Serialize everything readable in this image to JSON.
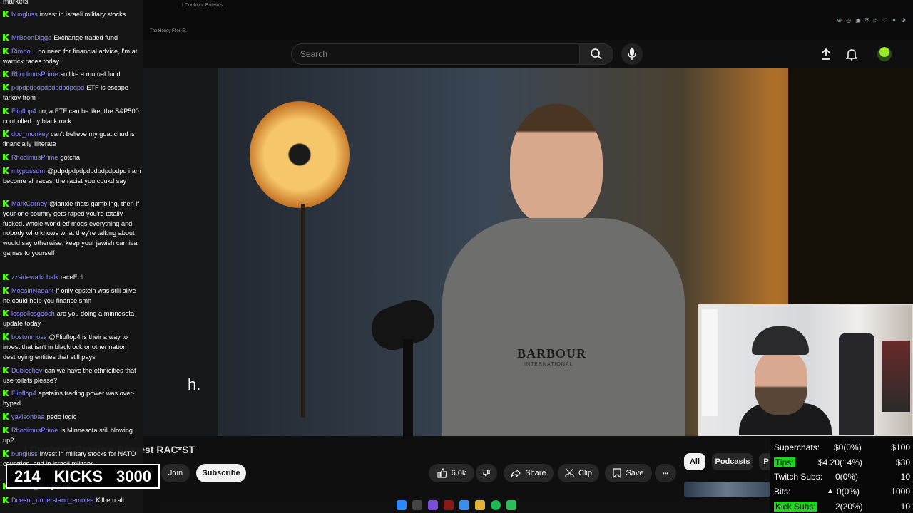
{
  "browser": {
    "tab_title": "I Confront Britain's ...",
    "bookmark_title": "The Honey Files E..."
  },
  "youtube_header": {
    "search_placeholder": "Search"
  },
  "video": {
    "caption_text": "h.",
    "sweatshirt_brand": "BARBOUR",
    "sweatshirt_sub": "INTERNATIONAL"
  },
  "below_video": {
    "title": "I Confront Britain's Biggest RAC*ST",
    "join_label": "Join",
    "subscribe_label": "Subscribe",
    "like_count": "6.6k",
    "share_label": "Share",
    "clip_label": "Clip",
    "save_label": "Save",
    "more_label": "•••"
  },
  "chips": {
    "all": "All",
    "podcasts": "Podcasts",
    "more": "P"
  },
  "chat": {
    "top_fragment": "markets",
    "messages": [
      {
        "user": "bungluss",
        "text": "invest in israeli military stocks"
      },
      {
        "user": "MrBoonDigga",
        "text": "Exchange traded fund"
      },
      {
        "user": "Rimbo...",
        "text": "no need for financial advice, I'm at warrick races today"
      },
      {
        "user": "RhodimusPrime",
        "text": "so like a mutual fund"
      },
      {
        "user": "pdpdpdpdpdpdpdpdpdpd",
        "text": "ETF is escape tarkov from"
      },
      {
        "user": "Flipflop4",
        "text": "no, a ETF can be like, the S&P500 controlled by black rock"
      },
      {
        "user": "doc_monkey",
        "text": "can't believe my goat chud is financially illiterate"
      },
      {
        "user": "RhodimusPrime",
        "text": "gotcha"
      },
      {
        "user": "mtypossum",
        "text": "@pdpdpdpdpdpdpdpdpdpd i am become all races. the racist you coukd say"
      },
      {
        "user": "MarkCarney",
        "text": "@lanxie thats gambling, then if your one country gets raped you're totally fucked. whole world etf mogs everything and nobody who knows what they're talking about would say otherwise, keep your jewish carnival games to yourself"
      },
      {
        "user": "zzsidewalkchalk",
        "text": "raceFUL"
      },
      {
        "user": "MoesinNagant",
        "text": "if only epstein was still alive he could help you finance smh"
      },
      {
        "user": "lospollosgooch",
        "text": "are you doing a minnesota update today"
      },
      {
        "user": "bostonmoss",
        "text": "@Flipflop4 is their a way to invest that isn't in blackrock or other nation destroying entities that still pays"
      },
      {
        "user": "Dubiechev",
        "text": "can we have the ethnicities that use toilets please?"
      },
      {
        "user": "Flipflop4",
        "text": "epsteins trading power was over-hyped"
      },
      {
        "user": "yakisohbaa",
        "text": "pedo logic"
      },
      {
        "user": "RhodimusPrime",
        "text": "Is Minnesota still blowing up?"
      },
      {
        "user": "bungluss",
        "text": "invest in military stocks for NATO countries, and in israeli military"
      },
      {
        "user": "SweatE_Yeti",
        "text": "gas em"
      },
      {
        "user": "Doesnt_understand_emotes",
        "text": "Kill em all"
      }
    ]
  },
  "kicks_counter": {
    "current": "214",
    "label": "KICKS",
    "goal": "3000"
  },
  "stats": {
    "rows": [
      {
        "label": "Superchats:",
        "value": "$0(0%)",
        "goal": "$100"
      },
      {
        "label": "Tips:",
        "value": "$4.20(14%)",
        "goal": "$30"
      },
      {
        "label": "Twitch Subs:",
        "value": "0(0%)",
        "goal": "10"
      },
      {
        "label": "Bits:",
        "value": "0(0%)",
        "goal": "1000"
      },
      {
        "label": "Kick Subs:",
        "value": "2(20%)",
        "goal": "10"
      }
    ]
  },
  "colors": {
    "kick_green": "#53fc18",
    "username_blue": "#8b8bff",
    "youtube_bg": "#0f0f0f"
  }
}
